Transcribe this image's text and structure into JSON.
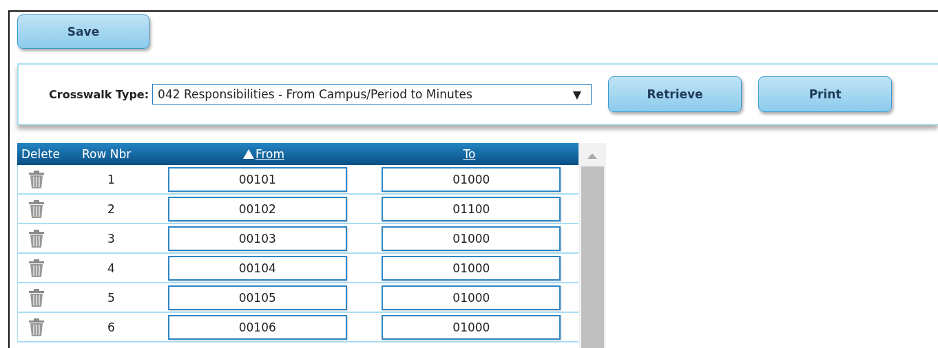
{
  "toolbar": {
    "save_button": "Save"
  },
  "filter": {
    "label": "Crosswalk Type:",
    "value": "042 Responsibilities - From Campus/Period to Minutes",
    "dropdown_arrow": "▼",
    "buttons": [
      "Retrieve",
      "Print"
    ]
  },
  "table": {
    "columns": [
      {
        "label": "Delete",
        "sortable": false,
        "sorted": false
      },
      {
        "label": "Row Nbr",
        "sortable": false,
        "sorted": false
      },
      {
        "label": "From",
        "sortable": true,
        "sorted": true
      },
      {
        "label": "To",
        "sortable": true,
        "sorted": false
      }
    ],
    "rows": [
      {
        "row_nbr": "1",
        "from": "00101",
        "to": "01000"
      },
      {
        "row_nbr": "2",
        "from": "00102",
        "to": "01100"
      },
      {
        "row_nbr": "3",
        "from": "00103",
        "to": "01000"
      },
      {
        "row_nbr": "4",
        "from": "00104",
        "to": "01000"
      },
      {
        "row_nbr": "5",
        "from": "00105",
        "to": "01000"
      },
      {
        "row_nbr": "6",
        "from": "00106",
        "to": "01000"
      }
    ]
  }
}
